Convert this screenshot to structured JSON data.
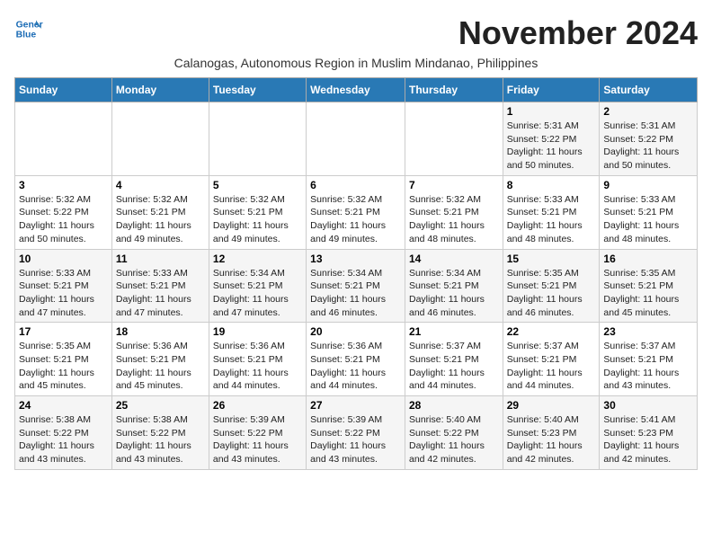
{
  "header": {
    "logo_line1": "General",
    "logo_line2": "Blue",
    "month": "November 2024",
    "subtitle": "Calanogas, Autonomous Region in Muslim Mindanao, Philippines"
  },
  "weekdays": [
    "Sunday",
    "Monday",
    "Tuesday",
    "Wednesday",
    "Thursday",
    "Friday",
    "Saturday"
  ],
  "weeks": [
    [
      {
        "day": "",
        "info": ""
      },
      {
        "day": "",
        "info": ""
      },
      {
        "day": "",
        "info": ""
      },
      {
        "day": "",
        "info": ""
      },
      {
        "day": "",
        "info": ""
      },
      {
        "day": "1",
        "info": "Sunrise: 5:31 AM\nSunset: 5:22 PM\nDaylight: 11 hours\nand 50 minutes."
      },
      {
        "day": "2",
        "info": "Sunrise: 5:31 AM\nSunset: 5:22 PM\nDaylight: 11 hours\nand 50 minutes."
      }
    ],
    [
      {
        "day": "3",
        "info": "Sunrise: 5:32 AM\nSunset: 5:22 PM\nDaylight: 11 hours\nand 50 minutes."
      },
      {
        "day": "4",
        "info": "Sunrise: 5:32 AM\nSunset: 5:21 PM\nDaylight: 11 hours\nand 49 minutes."
      },
      {
        "day": "5",
        "info": "Sunrise: 5:32 AM\nSunset: 5:21 PM\nDaylight: 11 hours\nand 49 minutes."
      },
      {
        "day": "6",
        "info": "Sunrise: 5:32 AM\nSunset: 5:21 PM\nDaylight: 11 hours\nand 49 minutes."
      },
      {
        "day": "7",
        "info": "Sunrise: 5:32 AM\nSunset: 5:21 PM\nDaylight: 11 hours\nand 48 minutes."
      },
      {
        "day": "8",
        "info": "Sunrise: 5:33 AM\nSunset: 5:21 PM\nDaylight: 11 hours\nand 48 minutes."
      },
      {
        "day": "9",
        "info": "Sunrise: 5:33 AM\nSunset: 5:21 PM\nDaylight: 11 hours\nand 48 minutes."
      }
    ],
    [
      {
        "day": "10",
        "info": "Sunrise: 5:33 AM\nSunset: 5:21 PM\nDaylight: 11 hours\nand 47 minutes."
      },
      {
        "day": "11",
        "info": "Sunrise: 5:33 AM\nSunset: 5:21 PM\nDaylight: 11 hours\nand 47 minutes."
      },
      {
        "day": "12",
        "info": "Sunrise: 5:34 AM\nSunset: 5:21 PM\nDaylight: 11 hours\nand 47 minutes."
      },
      {
        "day": "13",
        "info": "Sunrise: 5:34 AM\nSunset: 5:21 PM\nDaylight: 11 hours\nand 46 minutes."
      },
      {
        "day": "14",
        "info": "Sunrise: 5:34 AM\nSunset: 5:21 PM\nDaylight: 11 hours\nand 46 minutes."
      },
      {
        "day": "15",
        "info": "Sunrise: 5:35 AM\nSunset: 5:21 PM\nDaylight: 11 hours\nand 46 minutes."
      },
      {
        "day": "16",
        "info": "Sunrise: 5:35 AM\nSunset: 5:21 PM\nDaylight: 11 hours\nand 45 minutes."
      }
    ],
    [
      {
        "day": "17",
        "info": "Sunrise: 5:35 AM\nSunset: 5:21 PM\nDaylight: 11 hours\nand 45 minutes."
      },
      {
        "day": "18",
        "info": "Sunrise: 5:36 AM\nSunset: 5:21 PM\nDaylight: 11 hours\nand 45 minutes."
      },
      {
        "day": "19",
        "info": "Sunrise: 5:36 AM\nSunset: 5:21 PM\nDaylight: 11 hours\nand 44 minutes."
      },
      {
        "day": "20",
        "info": "Sunrise: 5:36 AM\nSunset: 5:21 PM\nDaylight: 11 hours\nand 44 minutes."
      },
      {
        "day": "21",
        "info": "Sunrise: 5:37 AM\nSunset: 5:21 PM\nDaylight: 11 hours\nand 44 minutes."
      },
      {
        "day": "22",
        "info": "Sunrise: 5:37 AM\nSunset: 5:21 PM\nDaylight: 11 hours\nand 44 minutes."
      },
      {
        "day": "23",
        "info": "Sunrise: 5:37 AM\nSunset: 5:21 PM\nDaylight: 11 hours\nand 43 minutes."
      }
    ],
    [
      {
        "day": "24",
        "info": "Sunrise: 5:38 AM\nSunset: 5:22 PM\nDaylight: 11 hours\nand 43 minutes."
      },
      {
        "day": "25",
        "info": "Sunrise: 5:38 AM\nSunset: 5:22 PM\nDaylight: 11 hours\nand 43 minutes."
      },
      {
        "day": "26",
        "info": "Sunrise: 5:39 AM\nSunset: 5:22 PM\nDaylight: 11 hours\nand 43 minutes."
      },
      {
        "day": "27",
        "info": "Sunrise: 5:39 AM\nSunset: 5:22 PM\nDaylight: 11 hours\nand 43 minutes."
      },
      {
        "day": "28",
        "info": "Sunrise: 5:40 AM\nSunset: 5:22 PM\nDaylight: 11 hours\nand 42 minutes."
      },
      {
        "day": "29",
        "info": "Sunrise: 5:40 AM\nSunset: 5:23 PM\nDaylight: 11 hours\nand 42 minutes."
      },
      {
        "day": "30",
        "info": "Sunrise: 5:41 AM\nSunset: 5:23 PM\nDaylight: 11 hours\nand 42 minutes."
      }
    ]
  ]
}
